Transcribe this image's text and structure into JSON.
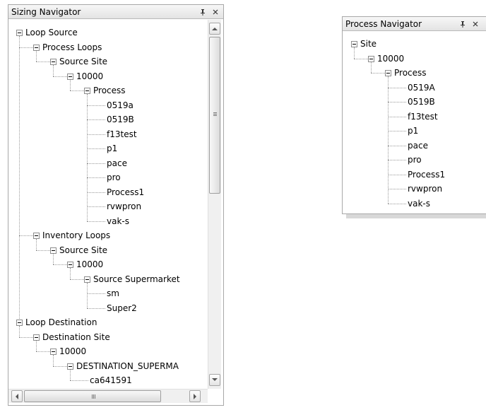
{
  "sizing": {
    "title": "Sizing Navigator",
    "nodes": [
      {
        "label": "Loop Source"
      },
      {
        "label": "Process Loops"
      },
      {
        "label": "Source Site"
      },
      {
        "label": "10000"
      },
      {
        "label": "Process"
      },
      {
        "label": "0519a"
      },
      {
        "label": "0519B"
      },
      {
        "label": "f13test"
      },
      {
        "label": "p1"
      },
      {
        "label": "pace"
      },
      {
        "label": "pro"
      },
      {
        "label": "Process1"
      },
      {
        "label": "rvwpron"
      },
      {
        "label": "vak-s"
      },
      {
        "label": "Inventory Loops"
      },
      {
        "label": "Source Site"
      },
      {
        "label": "10000"
      },
      {
        "label": "Source Supermarket"
      },
      {
        "label": "sm"
      },
      {
        "label": "Super2"
      },
      {
        "label": "Loop Destination"
      },
      {
        "label": "Destination Site"
      },
      {
        "label": "10000"
      },
      {
        "label": "DESTINATION_SUPERMA"
      },
      {
        "label": "ca641591"
      }
    ]
  },
  "process": {
    "title": "Process Navigator",
    "nodes": [
      {
        "label": "Site"
      },
      {
        "label": "10000"
      },
      {
        "label": "Process"
      },
      {
        "label": "0519A"
      },
      {
        "label": "0519B"
      },
      {
        "label": "f13test"
      },
      {
        "label": "p1"
      },
      {
        "label": "pace"
      },
      {
        "label": "pro"
      },
      {
        "label": "Process1"
      },
      {
        "label": "rvwpron"
      },
      {
        "label": "vak-s"
      }
    ]
  },
  "icons": {
    "pin": "pin-icon",
    "close": "close-icon",
    "collapse": "collapse-icon"
  },
  "colors": {
    "titlebar": "#e8e8e8",
    "border": "#a8a8a8",
    "tree_line": "#9a9a9a"
  }
}
